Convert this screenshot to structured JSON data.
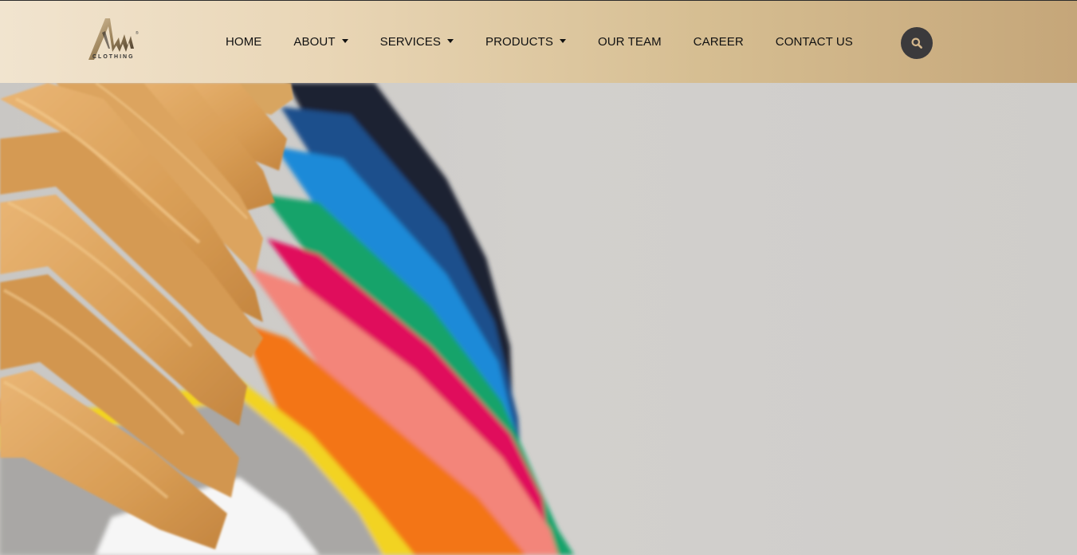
{
  "brand": {
    "logo_text": "CLOTHING",
    "logo_mark": "M",
    "logo_color": "#b89e76"
  },
  "nav": {
    "items": [
      {
        "label": "HOME",
        "dropdown": false
      },
      {
        "label": "ABOUT",
        "dropdown": true
      },
      {
        "label": "SERVICES",
        "dropdown": true
      },
      {
        "label": "PRODUCTS",
        "dropdown": true
      },
      {
        "label": "OUR TEAM",
        "dropdown": false
      },
      {
        "label": "CAREER",
        "dropdown": false
      },
      {
        "label": "CONTACT US",
        "dropdown": false
      }
    ]
  },
  "search": {
    "icon": "search-icon",
    "button_color": "#3b3a3c",
    "icon_color": "#d4b78c"
  },
  "hero": {
    "image": "colorful-t-shirts-on-wooden-hangers",
    "shirt_colors": [
      "#1c2430",
      "#1d4f8c",
      "#1b8ad8",
      "#13a36a",
      "#e0105c",
      "#f3857a",
      "#f37516",
      "#f2d320",
      "#a9a7a5",
      "#f6f6f6"
    ]
  }
}
